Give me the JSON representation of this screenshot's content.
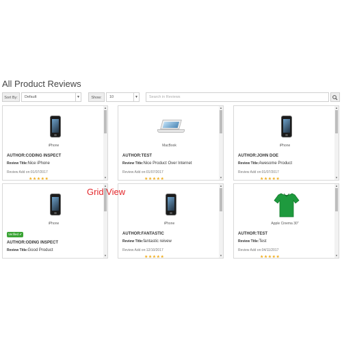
{
  "page": {
    "title": "All Product Reviews",
    "overlay_label": "Grid View"
  },
  "toolbar": {
    "sort_label": "Sort By:",
    "sort_value": "Default",
    "show_label": "Show:",
    "show_value": "10",
    "search_placeholder": "Search in Reviews"
  },
  "cards": [
    {
      "product": "iPhone",
      "author": "AUTHOR:CODING INSPECT",
      "title_label": "Review Title:",
      "title": "Nice iPhone",
      "date": "Review Add on:01/07/2017",
      "image": "iphone-icon",
      "verified": false
    },
    {
      "product": "MacBook",
      "author": "AUTHOR:TEST",
      "title_label": "Review Title:",
      "title": "Nice Product Over Internet",
      "date": "Review Add on:01/07/2017",
      "image": "macbook-icon",
      "verified": false
    },
    {
      "product": "iPhone",
      "author": "AUTHOR:JOHN DOE",
      "title_label": "Review Title:",
      "title": "Awesome Product",
      "date": "Review Add on:01/07/2017",
      "image": "iphone-icon",
      "verified": false
    },
    {
      "product": "iPhone",
      "author": "AUTHOR:ODING INSPECT",
      "title_label": "Review Title:",
      "title": "Good Product",
      "date": "",
      "image": "iphone-icon",
      "verified": true,
      "verified_label": "Verified"
    },
    {
      "product": "iPhone",
      "author": "AUTHOR:FANTASTIC",
      "title_label": "Review Title:",
      "title": "fantastic reivew",
      "date": "Review Add on:12/10/2017",
      "image": "iphone-icon",
      "verified": false
    },
    {
      "product": "Apple Cinema 30\"",
      "author": "AUTHOR:TEST",
      "title_label": "Review Title:",
      "title": "Test",
      "date": "Review Add on:04/11/2017",
      "image": "tshirt-icon",
      "verified": false
    }
  ],
  "colors": {
    "star": "#f0ad1e",
    "verified": "#3aa435",
    "overlay": "#e3272b",
    "shirt": "#1e9a3e"
  }
}
